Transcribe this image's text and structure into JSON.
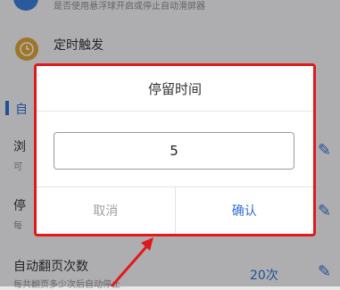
{
  "background": {
    "top_subtitle": "是否使用悬浮球开启或停止自动滑屏器",
    "timer_trigger_label": "定时触发",
    "section_label_partial": "自",
    "row1_label_partial": "浏",
    "row1_sub_partial": "可",
    "row2_label_partial": "停",
    "row2_sub_partial": "每",
    "auto_page_turn_label": "自动翻页次数",
    "auto_page_turn_sub": "每共翻页多少次后自动停止",
    "auto_page_turn_value": "20次"
  },
  "dialog": {
    "title": "停留时间",
    "input_value": "5",
    "cancel_label": "取消",
    "confirm_label": "确认"
  },
  "colors": {
    "accent": "#2f6fd2",
    "highlight_red": "#e0191b",
    "timer_icon": "#d9a43a"
  },
  "icons": {
    "timer": "clock-icon",
    "edit": "pencil-icon"
  }
}
